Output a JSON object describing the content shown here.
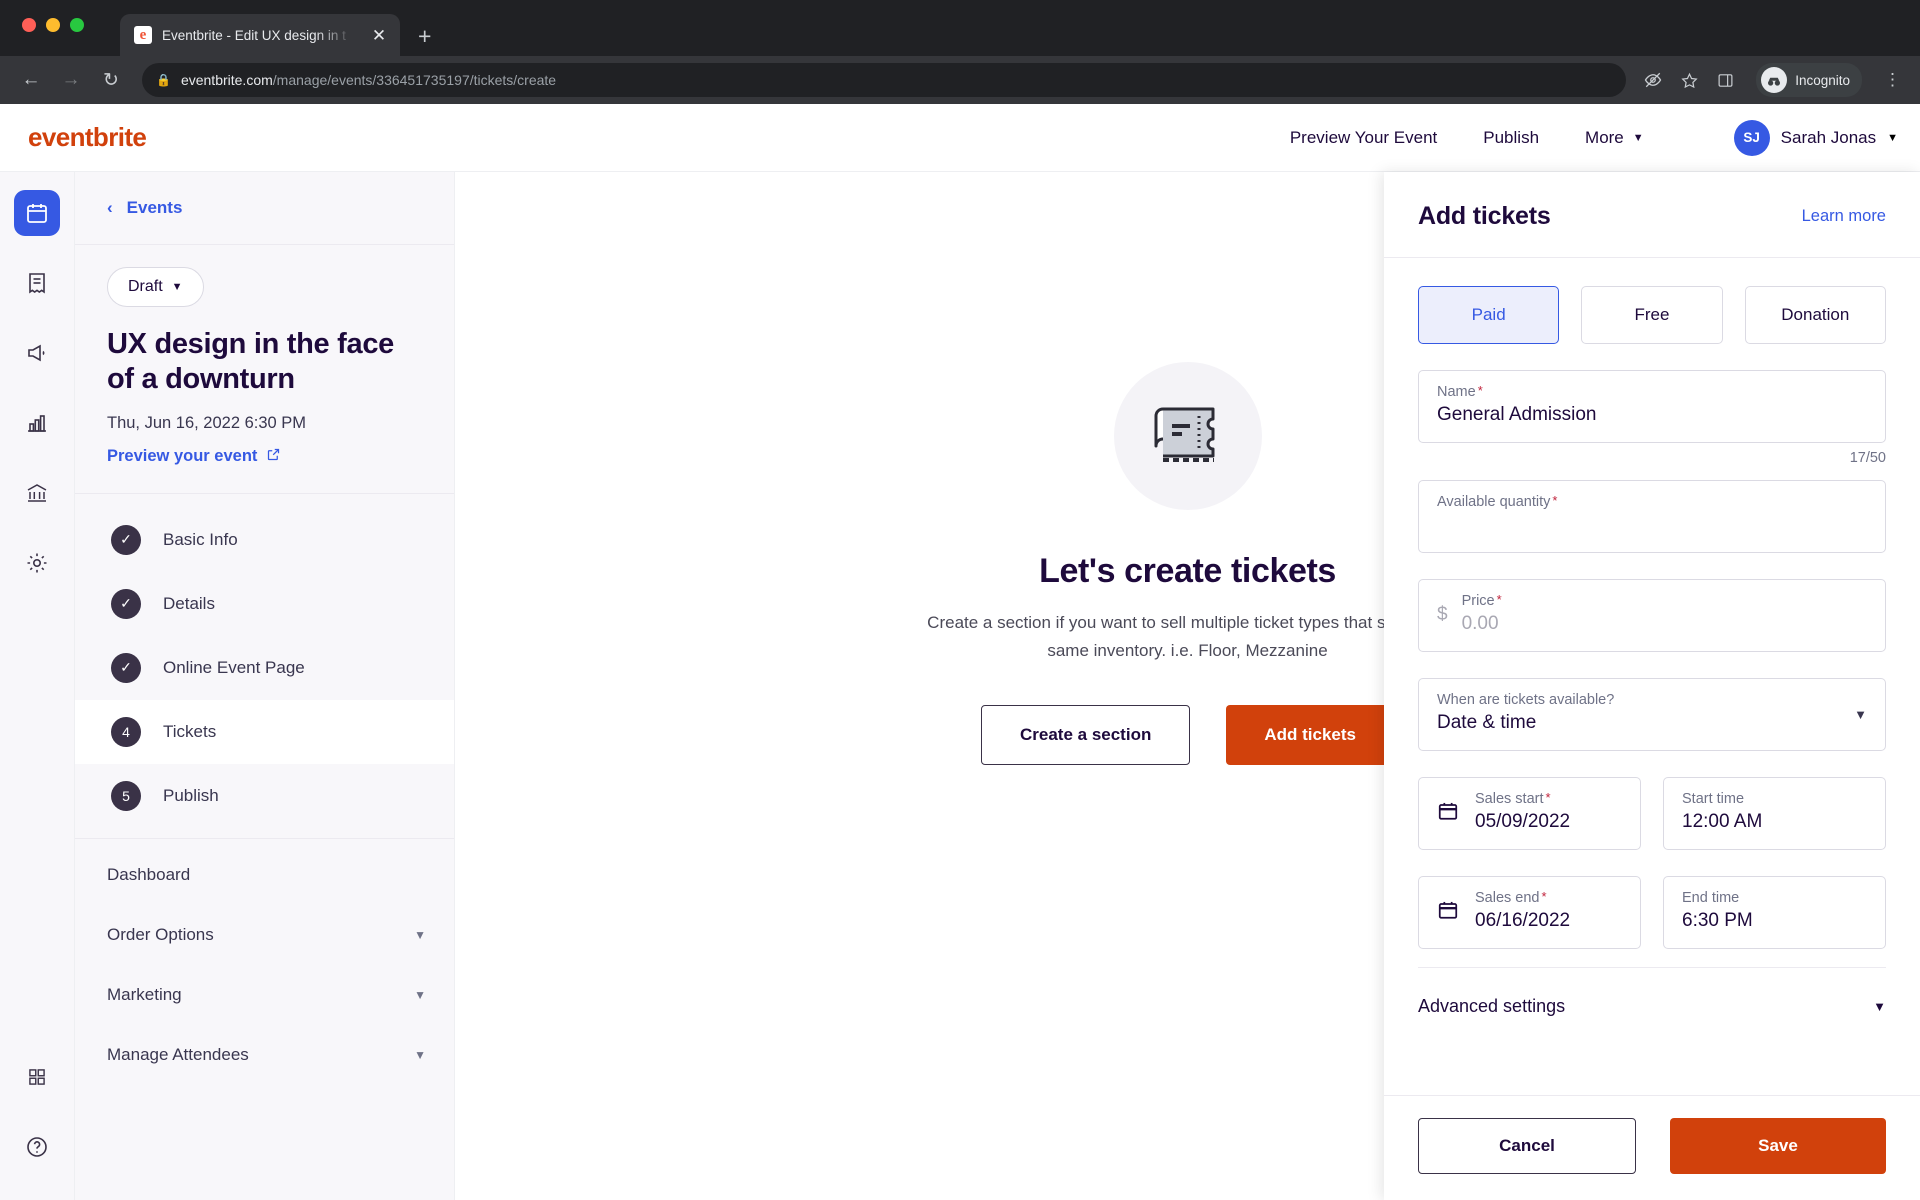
{
  "browser": {
    "tab": {
      "title": "Eventbrite - Edit UX design in t",
      "favicon_letter": "e",
      "close_icon": "close-icon",
      "new_tab_icon": "plus-icon"
    },
    "toolbar": {
      "back_icon": "back-arrow-icon",
      "forward_icon": "forward-arrow-icon",
      "reload_icon": "reload-icon",
      "lock_icon": "lock-icon",
      "url_domain": "eventbrite.com",
      "url_path": "/manage/events/336451735197/tickets/create",
      "eye_icon": "eye-off-icon",
      "star_icon": "star-icon",
      "sidepanel_icon": "side-panel-icon",
      "incognito_label": "Incognito",
      "incognito_icon": "incognito-avatar-icon",
      "menu_icon": "kebab-menu-icon"
    }
  },
  "header": {
    "logo": "eventbrite",
    "nav": [
      {
        "label": "Preview Your Event"
      },
      {
        "label": "Publish"
      },
      {
        "label": "More",
        "has_chevron": true
      }
    ],
    "user": {
      "initials": "SJ",
      "name": "Sarah Jonas",
      "chevron": "chevron-down-icon"
    }
  },
  "rail": {
    "items": [
      {
        "name": "calendar-icon",
        "active": true
      },
      {
        "name": "orders-icon",
        "active": false
      },
      {
        "name": "megaphone-icon",
        "active": false
      },
      {
        "name": "bar-chart-icon",
        "active": false
      },
      {
        "name": "bank-icon",
        "active": false
      },
      {
        "name": "gear-icon",
        "active": false
      }
    ],
    "bottom": [
      {
        "name": "apps-grid-icon"
      },
      {
        "name": "help-icon"
      }
    ]
  },
  "sidebar": {
    "back_label": "Events",
    "back_icon": "chevron-left-icon",
    "status": "Draft",
    "status_chevron": "chevron-down-icon",
    "event_title": "UX design in the face of a downturn",
    "event_date": "Thu, Jun 16, 2022 6:30 PM",
    "preview_link": "Preview your event",
    "preview_icon": "external-link-icon",
    "steps": [
      {
        "badge": "✓",
        "label": "Basic Info",
        "active": false
      },
      {
        "badge": "✓",
        "label": "Details",
        "active": false
      },
      {
        "badge": "✓",
        "label": "Online Event Page",
        "active": false
      },
      {
        "badge": "4",
        "label": "Tickets",
        "active": true
      },
      {
        "badge": "5",
        "label": "Publish",
        "active": false
      }
    ],
    "menu": [
      {
        "label": "Dashboard",
        "chevron": false
      },
      {
        "label": "Order Options",
        "chevron": true
      },
      {
        "label": "Marketing",
        "chevron": true
      },
      {
        "label": "Manage Attendees",
        "chevron": true
      }
    ]
  },
  "main": {
    "illustration_icon": "ticket-icon",
    "title": "Let's create tickets",
    "description": "Create a section if you want to sell multiple ticket types that share the same inventory. i.e. Floor, Mezzanine",
    "create_section_label": "Create a section",
    "add_tickets_label": "Add tickets"
  },
  "panel": {
    "title": "Add tickets",
    "learn_more": "Learn more",
    "ticket_types": [
      {
        "label": "Paid",
        "selected": true
      },
      {
        "label": "Free",
        "selected": false
      },
      {
        "label": "Donation",
        "selected": false
      }
    ],
    "name_field": {
      "label": "Name",
      "required": "*",
      "value": "General Admission",
      "counter": "17/50"
    },
    "quantity_field": {
      "label": "Available quantity",
      "required": "*",
      "value": ""
    },
    "price_field": {
      "label": "Price",
      "required": "*",
      "prefix": "$",
      "placeholder": "0.00"
    },
    "availability_field": {
      "label": "When are tickets available?",
      "value": "Date & time",
      "chevron": "chevron-down-icon"
    },
    "sales_start": {
      "label": "Sales start",
      "required": "*",
      "value": "05/09/2022",
      "icon": "calendar-icon"
    },
    "start_time": {
      "label": "Start time",
      "value": "12:00 AM"
    },
    "sales_end": {
      "label": "Sales end",
      "required": "*",
      "value": "06/16/2022",
      "icon": "calendar-icon"
    },
    "end_time": {
      "label": "End time",
      "value": "6:30 PM"
    },
    "advanced_label": "Advanced settings",
    "advanced_chevron": "chevron-down-icon",
    "cancel_label": "Cancel",
    "save_label": "Save"
  },
  "colors": {
    "brand": "#d1410c",
    "accent": "#3659e3",
    "dark": "#1e0a3c",
    "required": "#c0223b"
  }
}
